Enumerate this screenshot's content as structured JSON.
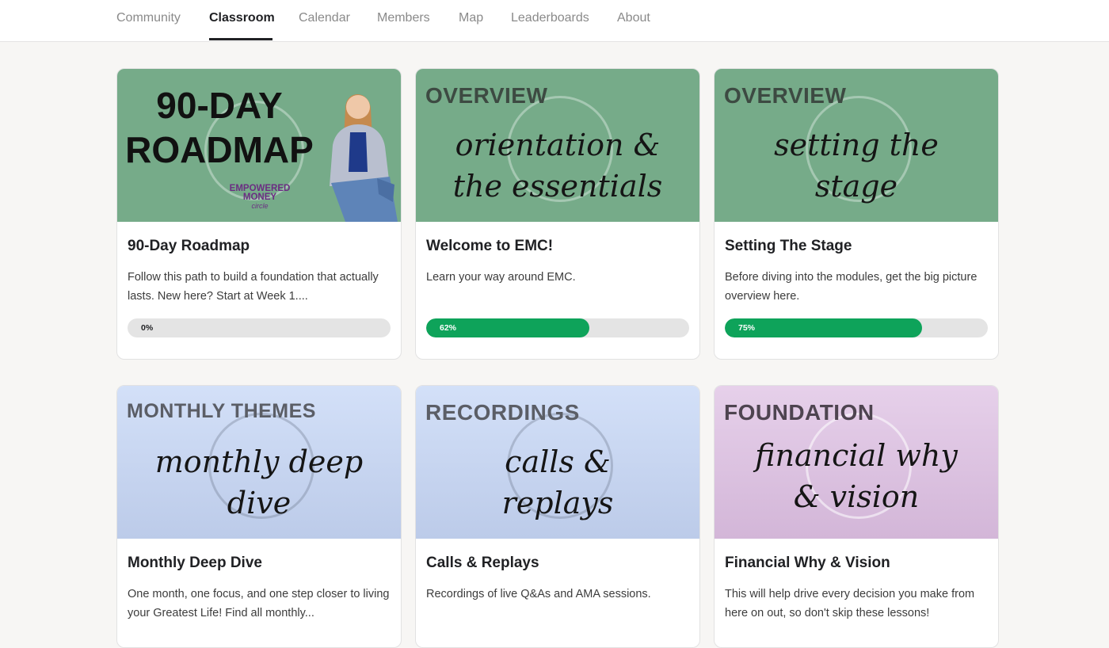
{
  "nav": {
    "tabs": [
      {
        "label": "Community"
      },
      {
        "label": "Classroom"
      },
      {
        "label": "Calendar"
      },
      {
        "label": "Members"
      },
      {
        "label": "Map"
      },
      {
        "label": "Leaderboards"
      },
      {
        "label": "About"
      }
    ],
    "active_tab": "Classroom"
  },
  "colors": {
    "green_card": "#76ab89",
    "blue_card": "#c5d5f2",
    "purple_card": "#d8bde0",
    "progress": "#0ea35a",
    "logo_purple": "#6b2d82"
  },
  "courses": [
    {
      "image": {
        "line1": "90-DAY",
        "line2": "ROADMAP",
        "logo_line1": "EMPOWERED",
        "logo_line2": "MONEY",
        "logo_line3": "circle"
      },
      "title": "90-Day Roadmap",
      "description": "Follow this path to build a foundation that actually lasts. New here? Start at Week 1....",
      "progress": 0,
      "progress_label": "0%"
    },
    {
      "image": {
        "heading": "OVERVIEW",
        "script_line1": "orientation &",
        "script_line2": "the essentials"
      },
      "title": "Welcome to EMC!",
      "description": "Learn your way around EMC.",
      "progress": 62,
      "progress_label": "62%"
    },
    {
      "image": {
        "heading": "OVERVIEW",
        "script_line1": "setting the",
        "script_line2": "stage"
      },
      "title": "Setting The Stage",
      "description": "Before diving into the modules, get the big picture overview here.",
      "progress": 75,
      "progress_label": "75%"
    },
    {
      "image": {
        "heading": "MONTHLY THEMES",
        "script_line1": "monthly deep",
        "script_line2": "dive"
      },
      "title": "Monthly Deep Dive",
      "description": "One month, one focus, and one step closer to living your Greatest Life! Find all monthly..."
    },
    {
      "image": {
        "heading": "RECORDINGS",
        "script_line1": "calls &",
        "script_line2": "replays"
      },
      "title": "Calls & Replays",
      "description": "Recordings of live Q&As and AMA sessions."
    },
    {
      "image": {
        "heading": "FOUNDATION",
        "script_line1": "financial why",
        "script_line2": "& vision"
      },
      "title": "Financial Why & Vision",
      "description": "This will help drive every decision you make from here on out, so don't skip these lessons!"
    }
  ]
}
